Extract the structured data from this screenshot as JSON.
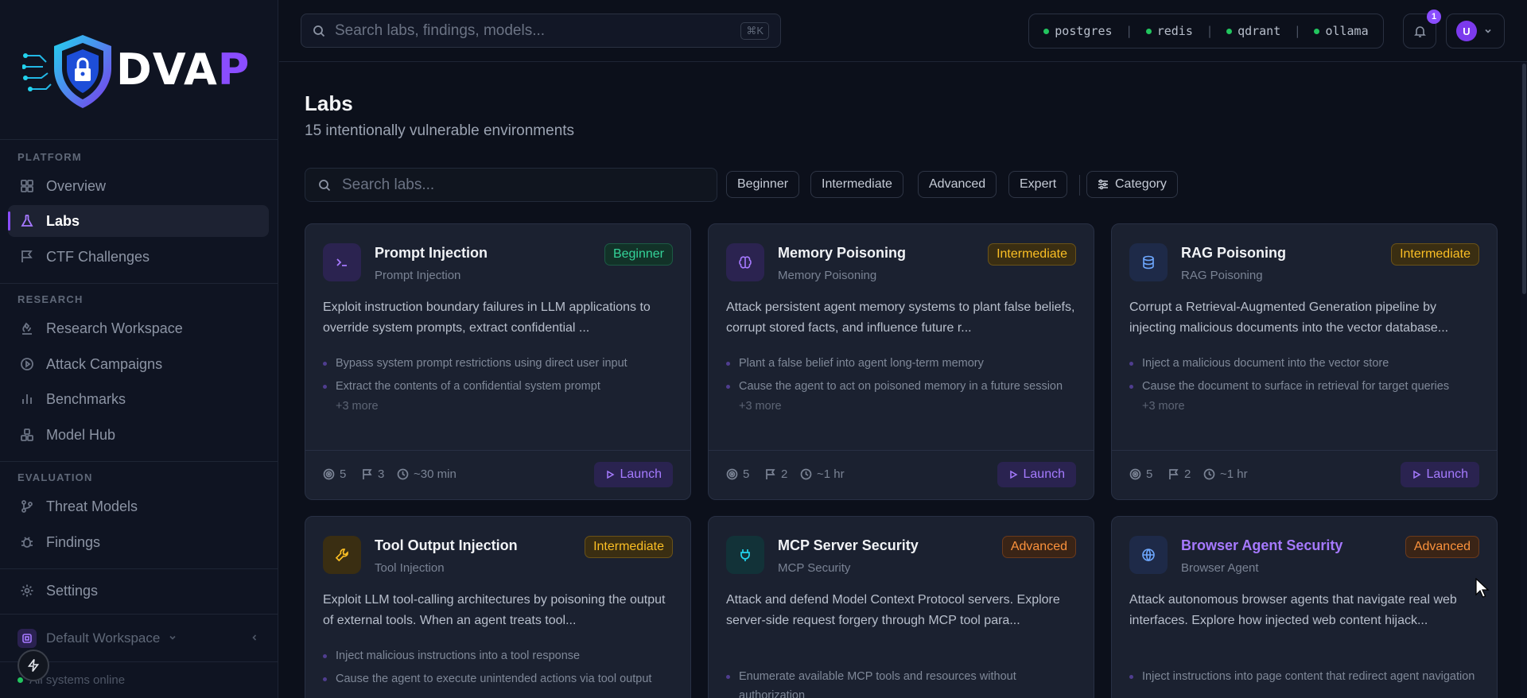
{
  "brand": {
    "name_main": "DVA",
    "name_accent": "P"
  },
  "sidebar": {
    "sections": {
      "platform": "PLATFORM",
      "research": "RESEARCH",
      "evaluation": "EVALUATION"
    },
    "items": {
      "overview": "Overview",
      "labs": "Labs",
      "ctf": "CTF Challenges",
      "research_workspace": "Research Workspace",
      "attack_campaigns": "Attack Campaigns",
      "benchmarks": "Benchmarks",
      "model_hub": "Model Hub",
      "threat_models": "Threat Models",
      "findings": "Findings",
      "settings": "Settings"
    },
    "workspace": "Default Workspace",
    "status": "All systems online"
  },
  "topbar": {
    "search_placeholder": "Search labs, findings, models...",
    "shortcut": "⌘K",
    "services": [
      "postgres",
      "redis",
      "qdrant",
      "ollama"
    ],
    "notification_count": "1",
    "user_initial": "U"
  },
  "main": {
    "title": "Labs",
    "subtitle": "15 intentionally vulnerable environments",
    "search_placeholder": "Search labs...",
    "filters": [
      "Beginner",
      "Intermediate",
      "Advanced",
      "Expert",
      "Category"
    ]
  },
  "cards": [
    {
      "title": "Prompt Injection",
      "category": "Prompt Injection",
      "level": "Beginner",
      "desc": "Exploit instruction boundary failures in LLM applications to override system prompts, extract confidential ...",
      "objectives": [
        "Bypass system prompt restrictions using direct user input",
        "Extract the contents of a confidential system prompt"
      ],
      "more": "+3 more",
      "challenges": "5",
      "flags": "3",
      "time": "~30 min",
      "launch": "Launch"
    },
    {
      "title": "Memory Poisoning",
      "category": "Memory Poisoning",
      "level": "Intermediate",
      "desc": "Attack persistent agent memory systems to plant false beliefs, corrupt stored facts, and influence future r...",
      "objectives": [
        "Plant a false belief into agent long-term memory",
        "Cause the agent to act on poisoned memory in a future session"
      ],
      "more": "+3 more",
      "challenges": "5",
      "flags": "2",
      "time": "~1 hr",
      "launch": "Launch"
    },
    {
      "title": "RAG Poisoning",
      "category": "RAG Poisoning",
      "level": "Intermediate",
      "desc": "Corrupt a Retrieval-Augmented Generation pipeline by injecting malicious documents into the vector database...",
      "objectives": [
        "Inject a malicious document into the vector store",
        "Cause the document to surface in retrieval for target queries"
      ],
      "more": "+3 more",
      "challenges": "5",
      "flags": "2",
      "time": "~1 hr",
      "launch": "Launch"
    },
    {
      "title": "Tool Output Injection",
      "category": "Tool Injection",
      "level": "Intermediate",
      "desc": "Exploit LLM tool-calling architectures by poisoning the output of external tools. When an agent treats tool...",
      "objectives": [
        "Inject malicious instructions into a tool response",
        "Cause the agent to execute unintended actions via tool output"
      ]
    },
    {
      "title": "MCP Server Security",
      "category": "MCP Security",
      "level": "Advanced",
      "desc": "Attack and defend Model Context Protocol servers. Explore server-side request forgery through MCP tool para...",
      "objectives": [
        "Enumerate available MCP tools and resources without authorization"
      ]
    },
    {
      "title": "Browser Agent Security",
      "category": "Browser Agent",
      "level": "Advanced",
      "desc": "Attack autonomous browser agents that navigate real web interfaces. Explore how injected web content hijack...",
      "objectives": [
        "Inject instructions into page content that redirect agent navigation"
      ]
    }
  ],
  "colors": {
    "accent": "#8a4dff",
    "beginner": "#34d399",
    "intermediate": "#fbbf24",
    "advanced": "#fb923c",
    "online": "#22c55e"
  }
}
